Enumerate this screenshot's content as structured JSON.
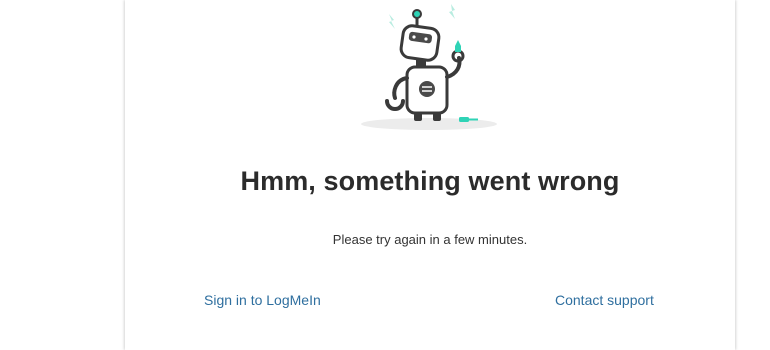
{
  "error": {
    "title": "Hmm, something went wrong",
    "message": "Please try again in a few minutes."
  },
  "links": {
    "sign_in": "Sign in to LogMeIn",
    "contact_support": "Contact support"
  },
  "illustration": {
    "icon": "robot-repair-icon"
  },
  "colors": {
    "accent": "#2fd3b6",
    "link": "#2f6f9f",
    "text": "#2b2b2b",
    "robot_stroke": "#3a3a3a"
  }
}
